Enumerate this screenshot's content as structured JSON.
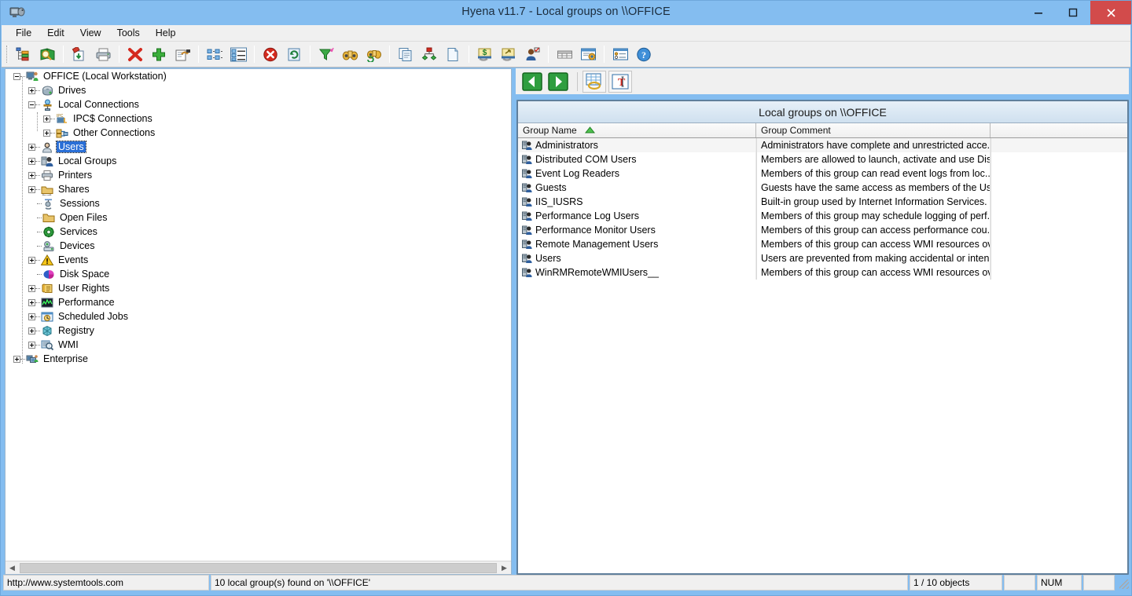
{
  "window": {
    "title": "Hyena v11.7 - Local groups on \\\\OFFICE",
    "app_icon": "hyena-app-icon",
    "minimize_label": "–",
    "maximize_label": "□",
    "close_label": "✕"
  },
  "menubar": {
    "items": [
      {
        "label": "File",
        "name": "menu-file"
      },
      {
        "label": "Edit",
        "name": "menu-edit"
      },
      {
        "label": "View",
        "name": "menu-view"
      },
      {
        "label": "Tools",
        "name": "menu-tools"
      },
      {
        "label": "Help",
        "name": "menu-help"
      }
    ]
  },
  "toolbar": {
    "buttons": [
      {
        "icon": "tree-view-icon",
        "name": "toolbar-tree-view"
      },
      {
        "icon": "find-book-icon",
        "name": "toolbar-find"
      },
      {
        "sep": true
      },
      {
        "icon": "export-down-icon",
        "name": "toolbar-export"
      },
      {
        "icon": "printer-icon",
        "name": "toolbar-print"
      },
      {
        "sep": true
      },
      {
        "icon": "delete-x-icon",
        "name": "toolbar-delete"
      },
      {
        "icon": "add-plus-icon",
        "name": "toolbar-add"
      },
      {
        "icon": "properties-icon",
        "name": "toolbar-properties"
      },
      {
        "sep": true
      },
      {
        "icon": "small-icons-view-icon",
        "name": "toolbar-small-icons"
      },
      {
        "icon": "details-view-icon",
        "name": "toolbar-details-view"
      },
      {
        "sep": true
      },
      {
        "icon": "stop-icon",
        "name": "toolbar-stop"
      },
      {
        "icon": "refresh-icon",
        "name": "toolbar-refresh"
      },
      {
        "sep": true
      },
      {
        "icon": "filter-icon",
        "name": "toolbar-filter"
      },
      {
        "icon": "binoculars-icon",
        "name": "toolbar-search"
      },
      {
        "icon": "binoculars-refresh-icon",
        "name": "toolbar-search-again"
      },
      {
        "sep": true
      },
      {
        "icon": "copy-icon",
        "name": "toolbar-copy"
      },
      {
        "icon": "org-chart-icon",
        "name": "toolbar-org-chart"
      },
      {
        "icon": "new-document-icon",
        "name": "toolbar-new-document"
      },
      {
        "sep": true
      },
      {
        "icon": "money-share-icon",
        "name": "toolbar-share-money"
      },
      {
        "icon": "share-folder-icon",
        "name": "toolbar-share-folder"
      },
      {
        "icon": "user-check-icon",
        "name": "toolbar-user"
      },
      {
        "sep": true
      },
      {
        "icon": "grid-icon",
        "name": "toolbar-grid"
      },
      {
        "icon": "window-settings-icon",
        "name": "toolbar-window-settings"
      },
      {
        "sep": true
      },
      {
        "icon": "options-list-icon",
        "name": "toolbar-options"
      },
      {
        "icon": "help-icon",
        "name": "toolbar-help"
      }
    ]
  },
  "tree": {
    "items": [
      {
        "label": "OFFICE (Local Workstation)",
        "depth": 0,
        "state": "expanded",
        "icon": "computer-icon",
        "selected": false,
        "name": "tree-item-office"
      },
      {
        "label": "Drives",
        "depth": 1,
        "state": "collapsed",
        "icon": "drive-icon",
        "selected": false,
        "name": "tree-item-drives"
      },
      {
        "label": "Local Connections",
        "depth": 1,
        "state": "expanded",
        "icon": "connection-icon",
        "selected": false,
        "name": "tree-item-local-connections"
      },
      {
        "label": "IPC$ Connections",
        "depth": 2,
        "state": "collapsed",
        "icon": "ipc-connection-icon",
        "selected": false,
        "name": "tree-item-ipc-connections"
      },
      {
        "label": "Other Connections",
        "depth": 2,
        "state": "collapsed",
        "icon": "other-connection-icon",
        "selected": false,
        "name": "tree-item-other-connections"
      },
      {
        "label": "Users",
        "depth": 1,
        "state": "collapsed",
        "icon": "user-icon",
        "selected": true,
        "name": "tree-item-users"
      },
      {
        "label": "Local Groups",
        "depth": 1,
        "state": "collapsed",
        "icon": "group-icon",
        "selected": false,
        "name": "tree-item-local-groups"
      },
      {
        "label": "Printers",
        "depth": 1,
        "state": "collapsed",
        "icon": "printer-icon",
        "selected": false,
        "name": "tree-item-printers"
      },
      {
        "label": "Shares",
        "depth": 1,
        "state": "collapsed",
        "icon": "share-icon",
        "selected": false,
        "name": "tree-item-shares"
      },
      {
        "label": "Sessions",
        "depth": 1,
        "state": "leaf",
        "icon": "sessions-icon",
        "selected": false,
        "name": "tree-item-sessions"
      },
      {
        "label": "Open Files",
        "depth": 1,
        "state": "leaf",
        "icon": "folder-icon",
        "selected": false,
        "name": "tree-item-open-files"
      },
      {
        "label": "Services",
        "depth": 1,
        "state": "leaf",
        "icon": "services-gear-icon",
        "selected": false,
        "name": "tree-item-services"
      },
      {
        "label": "Devices",
        "depth": 1,
        "state": "leaf",
        "icon": "devices-icon",
        "selected": false,
        "name": "tree-item-devices"
      },
      {
        "label": "Events",
        "depth": 1,
        "state": "collapsed",
        "icon": "warning-icon",
        "selected": false,
        "name": "tree-item-events"
      },
      {
        "label": "Disk Space",
        "depth": 1,
        "state": "leaf",
        "icon": "disk-space-icon",
        "selected": false,
        "name": "tree-item-disk-space"
      },
      {
        "label": "User Rights",
        "depth": 1,
        "state": "collapsed",
        "icon": "scroll-icon",
        "selected": false,
        "name": "tree-item-user-rights"
      },
      {
        "label": "Performance",
        "depth": 1,
        "state": "collapsed",
        "icon": "performance-graph-icon",
        "selected": false,
        "name": "tree-item-performance"
      },
      {
        "label": "Scheduled Jobs",
        "depth": 1,
        "state": "collapsed",
        "icon": "clock-icon",
        "selected": false,
        "name": "tree-item-scheduled-jobs"
      },
      {
        "label": "Registry",
        "depth": 1,
        "state": "collapsed",
        "icon": "registry-icon",
        "selected": false,
        "name": "tree-item-registry"
      },
      {
        "label": "WMI",
        "depth": 1,
        "state": "collapsed",
        "icon": "wmi-magnifier-icon",
        "selected": false,
        "name": "tree-item-wmi"
      },
      {
        "label": "Enterprise",
        "depth": 0,
        "state": "collapsed",
        "icon": "enterprise-icon",
        "selected": false,
        "name": "tree-item-enterprise"
      }
    ]
  },
  "right_toolbar": {
    "buttons": [
      {
        "icon": "back-arrow-icon",
        "name": "nav-back-button"
      },
      {
        "icon": "forward-arrow-icon",
        "name": "nav-forward-button"
      },
      {
        "sep": true
      },
      {
        "icon": "grid-export-icon",
        "name": "grid-export-button",
        "framed": true
      },
      {
        "icon": "text-tool-icon",
        "name": "text-tool-button",
        "framed": true
      }
    ]
  },
  "list": {
    "caption": "Local groups on \\\\OFFICE",
    "columns": [
      {
        "label": "Group Name",
        "sorted": "asc",
        "name": "column-group-name"
      },
      {
        "label": "Group Comment",
        "sorted": "none",
        "name": "column-group-comment"
      },
      {
        "label": "",
        "sorted": "none",
        "name": "column-extra"
      }
    ],
    "sort_arrow": "▲",
    "rows": [
      {
        "name": "Administrators",
        "comment": "Administrators have complete and unrestricted acce..."
      },
      {
        "name": "Distributed COM Users",
        "comment": "Members are allowed to launch, activate and use Dis..."
      },
      {
        "name": "Event Log Readers",
        "comment": "Members of this group can read event logs from loc..."
      },
      {
        "name": "Guests",
        "comment": "Guests have the same access as members of the User..."
      },
      {
        "name": "IIS_IUSRS",
        "comment": "Built-in group used by Internet Information Services."
      },
      {
        "name": "Performance Log Users",
        "comment": "Members of this group may schedule logging of perf..."
      },
      {
        "name": "Performance Monitor Users",
        "comment": "Members of this group can access performance cou..."
      },
      {
        "name": "Remote Management Users",
        "comment": "Members of this group can access WMI resources ov..."
      },
      {
        "name": "Users",
        "comment": "Users are prevented from making accidental or inten..."
      },
      {
        "name": "WinRMRemoteWMIUsers__",
        "comment": "Members of this group can access WMI resources ov..."
      }
    ]
  },
  "statusbar": {
    "url": "http://www.systemtools.com",
    "message": "10 local group(s) found on '\\\\OFFICE'",
    "count": "1 / 10 objects",
    "blank1": "",
    "num": "NUM",
    "blank2": ""
  },
  "colors": {
    "titlebar": "#84bdf0",
    "close_button": "#d24b4b",
    "selection": "#2a6fd6",
    "panel_border": "#5f7f9c",
    "caption_gradient_top": "#e7f0f8",
    "caption_gradient_bottom": "#cfe0ef"
  }
}
